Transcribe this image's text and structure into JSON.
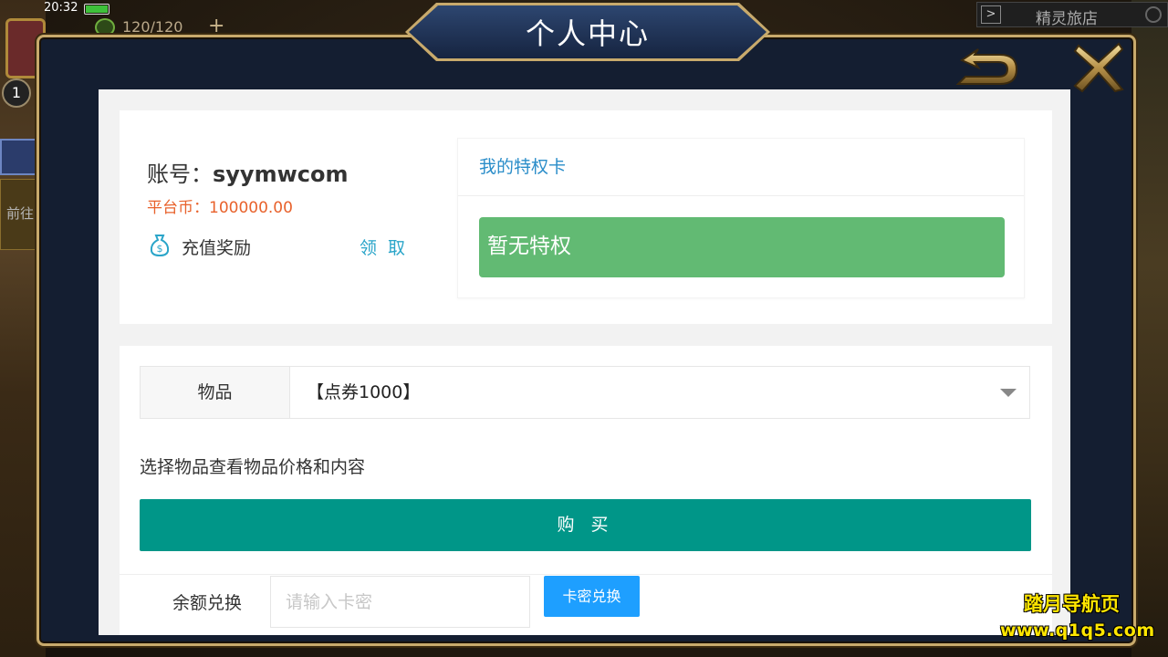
{
  "status_bar": {
    "time": "20:32"
  },
  "stamina": {
    "value": "120/120",
    "plus": "+"
  },
  "level_badge": "1",
  "left_goto": "前往",
  "top_right": {
    "arrow": ">",
    "title": "精灵旅店"
  },
  "dialog": {
    "title": "个人中心"
  },
  "account": {
    "label": "账号：",
    "username": "syymwcom",
    "coin_label": "平台币：",
    "coin_value": "100000.00",
    "reward_label": "充值奖励",
    "claim_label": "领 取"
  },
  "privilege": {
    "header": "我的特权卡",
    "empty": "暂无特权"
  },
  "shop": {
    "item_label": "物品",
    "selected_item": "【点券1000】",
    "hint": "选择物品查看物品价格和内容",
    "buy_label": "购 买"
  },
  "redeem": {
    "label": "余额兑换",
    "placeholder": "请输入卡密",
    "button": "卡密兑换"
  },
  "watermark": {
    "line1": "踏月导航页",
    "line2": "www.q1q5.com"
  },
  "colors": {
    "frame_gold": "#c8aa6c",
    "frame_dark": "#141e31",
    "coin_orange": "#e8622c",
    "link_blue": "#2a8dc9",
    "privilege_green": "#62ba73",
    "buy_teal": "#009688",
    "redeem_blue": "#1e9fff",
    "watermark_yellow": "#ffe600"
  },
  "icons": {
    "reward": "money-bag-icon",
    "back": "back-arrow-icon",
    "close": "close-x-icon",
    "caret": "chevron-down-icon",
    "search": "search-icon"
  }
}
